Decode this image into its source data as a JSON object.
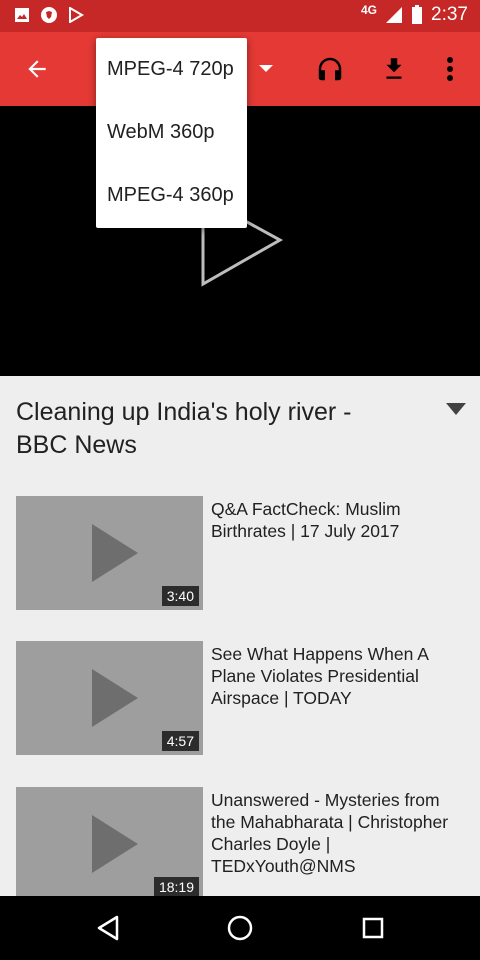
{
  "status_bar": {
    "network": "4G",
    "time": "2:37"
  },
  "quality_menu": {
    "options": [
      {
        "label": "MPEG-4 720p"
      },
      {
        "label": "WebM 360p"
      },
      {
        "label": "MPEG-4 360p"
      }
    ]
  },
  "video": {
    "title": "Cleaning up India's holy river - BBC News"
  },
  "related": [
    {
      "title": "Q&A FactCheck: Muslim Birthrates | 17 July 2017",
      "duration": "3:40"
    },
    {
      "title": "See What Happens When A Plane Violates Presidential Airspace | TODAY",
      "duration": "4:57"
    },
    {
      "title": "Unanswered - Mysteries from the Mahabharata | Christopher Charles Doyle | TEDxYouth@NMS",
      "duration": "18:19"
    }
  ],
  "colors": {
    "status_bar": "#c62828",
    "toolbar": "#e53935",
    "player": "#000000",
    "thumbnail": "#9e9e9e"
  }
}
